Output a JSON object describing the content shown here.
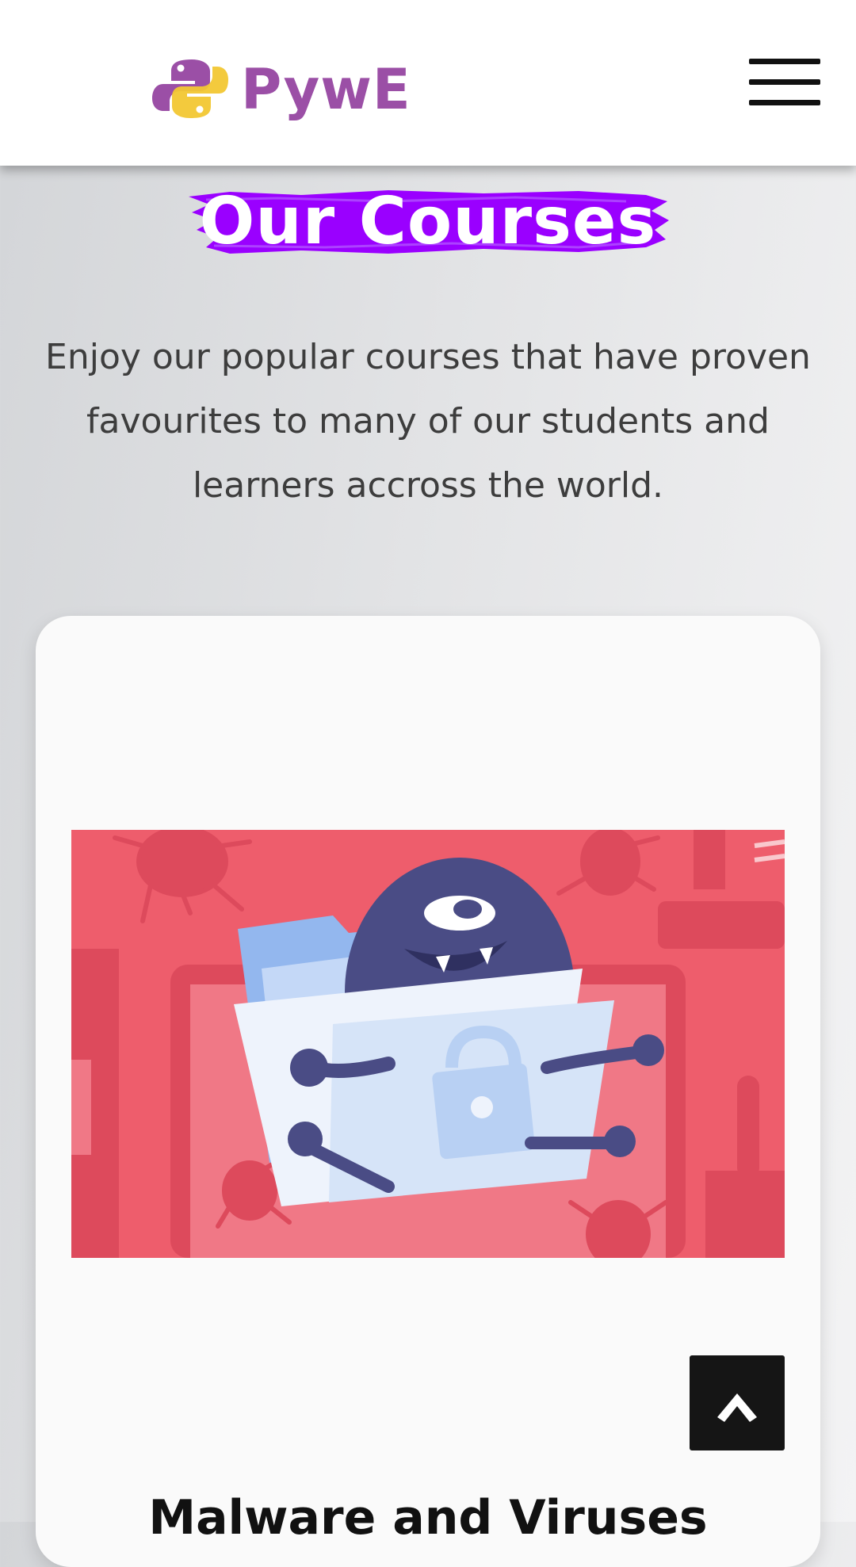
{
  "header": {
    "logo_text": "PywE",
    "logo_icon": "python-logo-icon",
    "menu_icon": "hamburger-menu-icon"
  },
  "section": {
    "title": "Our Courses",
    "subtitle": "Enjoy our popular courses that have proven favourites to many of our students and learners accross the world."
  },
  "course_card": {
    "image_icon": "malware-monster-illustration",
    "title": "Malware and Viruses"
  },
  "scroll_top": {
    "icon": "chevron-up-icon"
  },
  "colors": {
    "brand_purple": "#9b4fa6",
    "brush_violet": "#9a00ff",
    "illustration_red": "#ee5d6c",
    "monster_navy": "#4a4c85"
  }
}
